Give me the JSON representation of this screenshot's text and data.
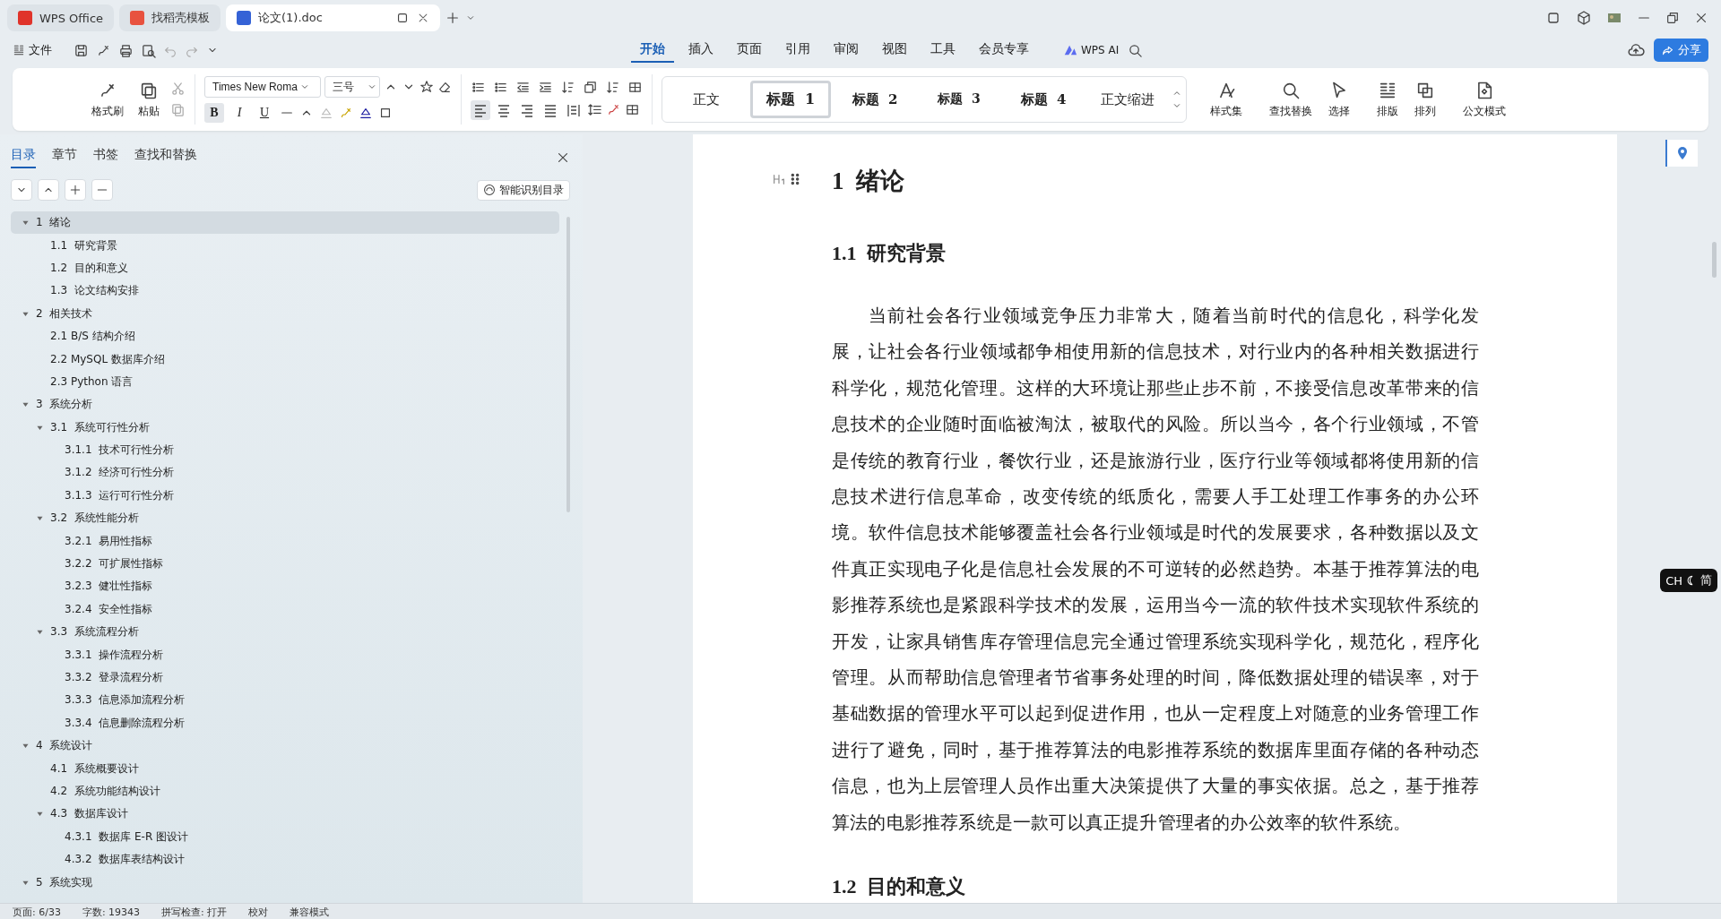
{
  "browser_tabs": [
    {
      "kind": "home",
      "label": "WPS Office",
      "selected": false
    },
    {
      "kind": "template",
      "label": "找稻壳模板",
      "selected": false
    },
    {
      "kind": "doc",
      "label": "论文(1).doc",
      "selected": true
    }
  ],
  "menu_bar": {
    "file": "文件",
    "tabs": [
      {
        "label": "开始",
        "selected": true
      },
      {
        "label": "插入",
        "selected": false
      },
      {
        "label": "页面",
        "selected": false
      },
      {
        "label": "引用",
        "selected": false
      },
      {
        "label": "审阅",
        "selected": false
      },
      {
        "label": "视图",
        "selected": false
      },
      {
        "label": "工具",
        "selected": false
      },
      {
        "label": "会员专享",
        "selected": false
      }
    ],
    "ai": "WPS AI",
    "share": "分享"
  },
  "ribbon": {
    "format_painter": "格式刷",
    "paste": "粘贴",
    "font_name": "Times New Roma",
    "font_size": "三号",
    "toggles": [
      {
        "kind": "bold",
        "label": "B",
        "selected": true
      },
      {
        "kind": "italic",
        "label": "I",
        "selected": false
      },
      {
        "kind": "underline",
        "label": "U",
        "selected": false
      }
    ],
    "alignment": [
      {
        "kind": "left",
        "selected": true
      },
      {
        "kind": "center",
        "selected": false
      },
      {
        "kind": "right",
        "selected": false
      },
      {
        "kind": "justify",
        "selected": false
      },
      {
        "kind": "distributed",
        "selected": false
      }
    ],
    "styles": [
      {
        "kind": "body",
        "label": "正文",
        "selected": false
      },
      {
        "kind": "h1",
        "label": "标题  1",
        "selected": true
      },
      {
        "kind": "h2",
        "label": "标题  2",
        "selected": false
      },
      {
        "kind": "h3",
        "label": "标题  3",
        "selected": false
      },
      {
        "kind": "h4",
        "label": "标题  4",
        "selected": false
      },
      {
        "kind": "body",
        "label": "正文缩进",
        "selected": false
      }
    ],
    "tools": [
      {
        "kind": "styles",
        "label": "样式集"
      },
      {
        "kind": "find",
        "label": "查找替换"
      },
      {
        "kind": "select",
        "label": "选择"
      },
      {
        "kind": "layout",
        "label": "排版"
      },
      {
        "kind": "arrange",
        "label": "排列"
      },
      {
        "kind": "official",
        "label": "公文模式"
      }
    ]
  },
  "nav_panel": {
    "tabs": [
      {
        "label": "目录",
        "selected": true
      },
      {
        "label": "章节",
        "selected": false
      },
      {
        "label": "书签",
        "selected": false
      },
      {
        "label": "查找和替换",
        "selected": false
      }
    ],
    "smart_button": "智能识别目录",
    "outline": [
      {
        "label": "1  绪论",
        "selected": true,
        "expanded": true,
        "children": [
          {
            "label": "1.1  研究背景",
            "selected": false
          },
          {
            "label": "1.2  目的和意义",
            "selected": false
          },
          {
            "label": "1.3  论文结构安排",
            "selected": false
          }
        ]
      },
      {
        "label": "2  相关技术",
        "selected": false,
        "expanded": true,
        "children": [
          {
            "label": "2.1 B/S 结构介绍",
            "selected": false
          },
          {
            "label": "2.2 MySQL 数据库介绍",
            "selected": false
          },
          {
            "label": "2.3 Python 语言",
            "selected": false
          }
        ]
      },
      {
        "label": "3  系统分析",
        "selected": false,
        "expanded": true,
        "children": [
          {
            "label": "3.1  系统可行性分析",
            "selected": false,
            "expanded": true,
            "children": [
              {
                "label": "3.1.1  技术可行性分析",
                "selected": false
              },
              {
                "label": "3.1.2  经济可行性分析",
                "selected": false
              },
              {
                "label": "3.1.3  运行可行性分析",
                "selected": false
              }
            ]
          },
          {
            "label": "3.2  系统性能分析",
            "selected": false,
            "expanded": true,
            "children": [
              {
                "label": "3.2.1  易用性指标",
                "selected": false
              },
              {
                "label": "3.2.2  可扩展性指标",
                "selected": false
              },
              {
                "label": "3.2.3  健壮性指标",
                "selected": false
              },
              {
                "label": "3.2.4  安全性指标",
                "selected": false
              }
            ]
          },
          {
            "label": "3.3  系统流程分析",
            "selected": false,
            "expanded": true,
            "children": [
              {
                "label": "3.3.1  操作流程分析",
                "selected": false
              },
              {
                "label": "3.3.2  登录流程分析",
                "selected": false
              },
              {
                "label": "3.3.3  信息添加流程分析",
                "selected": false
              },
              {
                "label": "3.3.4  信息删除流程分析",
                "selected": false
              }
            ]
          }
        ]
      },
      {
        "label": "4  系统设计",
        "selected": false,
        "expanded": true,
        "children": [
          {
            "label": "4.1  系统概要设计",
            "selected": false
          },
          {
            "label": "4.2  系统功能结构设计",
            "selected": false
          },
          {
            "label": "4.3  数据库设计",
            "selected": false,
            "expanded": true,
            "children": [
              {
                "label": "4.3.1  数据库 E-R 图设计",
                "selected": false
              },
              {
                "label": "4.3.2  数据库表结构设计",
                "selected": false
              }
            ]
          }
        ]
      },
      {
        "label": "5  系统实现",
        "selected": false,
        "expanded": true
      }
    ]
  },
  "document": {
    "blocks": [
      {
        "kind": "h1",
        "text": "1  绪论"
      },
      {
        "kind": "h2",
        "text": "1.1  研究背景"
      },
      {
        "kind": "p",
        "text": "当前社会各行业领域竞争压力非常大，随着当前时代的信息化，科学化发展，让社会各行业领域都争相使用新的信息技术，对行业内的各种相关数据进行科学化，规范化管理。这样的大环境让那些止步不前，不接受信息改革带来的信息技术的企业随时面临被淘汰，被取代的风险。所以当今，各个行业领域，不管是传统的教育行业，餐饮行业，还是旅游行业，医疗行业等领域都将使用新的信息技术进行信息革命，改变传统的纸质化，需要人手工处理工作事务的办公环境。软件信息技术能够覆盖社会各行业领域是时代的发展要求，各种数据以及文件真正实现电子化是信息社会发展的不可逆转的必然趋势。本基于推荐算法的电影推荐系统也是紧跟科学技术的发展，运用当今一流的软件技术实现软件系统的开发，让家具销售库存管理信息完全通过管理系统实现科学化，规范化，程序化管理。从而帮助信息管理者节省事务处理的时间，降低数据处理的错误率，对于基础数据的管理水平可以起到促进作用，也从一定程度上对随意的业务管理工作进行了避免，同时，基于推荐算法的电影推荐系统的数据库里面存储的各种动态信息，也为上层管理人员作出重大决策提供了大量的事实依据。总之，基于推荐算法的电影推荐系统是一款可以真正提升管理者的办公效率的软件系统。"
      },
      {
        "kind": "h2",
        "text": "1.2  目的和意义"
      }
    ]
  },
  "ime": {
    "lang": "CH",
    "mode": "简"
  },
  "status_bar": [
    "页面: 6/33",
    "字数: 19343",
    "拼写检查: 打开",
    "校对",
    "兼容模式"
  ]
}
